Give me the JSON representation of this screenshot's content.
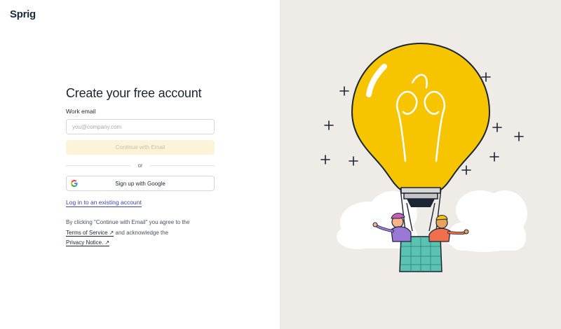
{
  "brand": {
    "logo_text": "Sprig"
  },
  "signup": {
    "title": "Create your free account",
    "email_label": "Work email",
    "email_placeholder": "you@company.com",
    "email_value": "",
    "continue_label": "Continue with Email",
    "divider_text": "or",
    "google_label": "Sign up with Google",
    "login_link": "Log in to an existing account"
  },
  "legal": {
    "prefix": "By clicking \"Continue with Email\" you agree to the",
    "terms_label": "Terms of Service",
    "middle": "and acknowledge the",
    "privacy_label": "Privacy Notice.",
    "external_icon": "arrow-up-right-icon"
  },
  "illustration": {
    "subject": "lightbulb-hot-air-balloon-illustration"
  },
  "colors": {
    "accent_link": "#3c45a8",
    "button_disabled_bg": "#fdf3d8",
    "right_panel_bg": "#efebe6",
    "bulb_yellow": "#f7c400"
  }
}
